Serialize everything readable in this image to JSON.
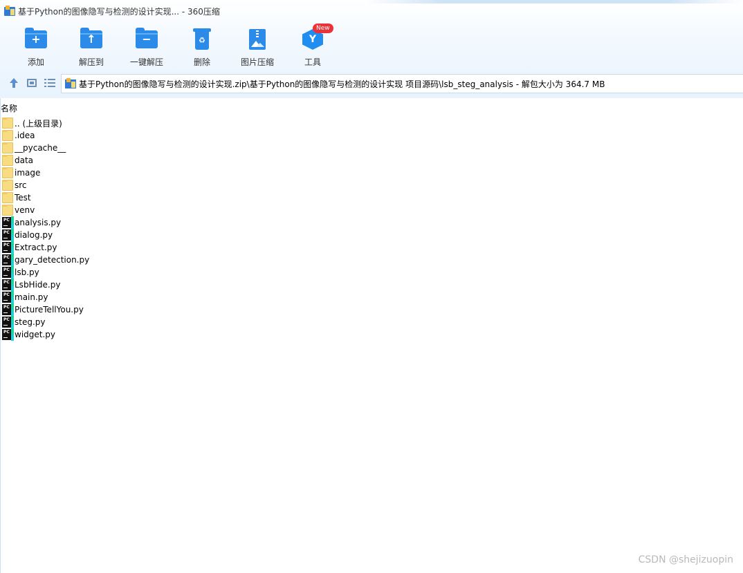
{
  "window": {
    "title": "基于Python的图像隐写与检测的设计实现... - 360压缩"
  },
  "toolbar": {
    "tools": [
      {
        "label": "添加",
        "icon": "add-folder-icon"
      },
      {
        "label": "解压到",
        "icon": "extract-to-icon"
      },
      {
        "label": "一键解压",
        "icon": "one-click-extract-icon"
      },
      {
        "label": "删除",
        "icon": "recycle-bin-icon"
      },
      {
        "label": "图片压缩",
        "icon": "image-compress-icon"
      },
      {
        "label": "工具",
        "icon": "tools-icon",
        "badge": "New"
      }
    ]
  },
  "address": {
    "path": "基于Python的图像隐写与检测的设计实现.zip\\基于Python的图像隐写与检测的设计实现 项目源码\\lsb_steg_analysis - 解包大小为 364.7 MB"
  },
  "list": {
    "column_name": "名称",
    "items": [
      {
        "name": ".. (上级目录)",
        "type": "folder"
      },
      {
        "name": ".idea",
        "type": "folder"
      },
      {
        "name": "__pycache__",
        "type": "folder"
      },
      {
        "name": "data",
        "type": "folder"
      },
      {
        "name": "image",
        "type": "folder"
      },
      {
        "name": "src",
        "type": "folder"
      },
      {
        "name": "Test",
        "type": "folder"
      },
      {
        "name": "venv",
        "type": "folder"
      },
      {
        "name": "analysis.py",
        "type": "py"
      },
      {
        "name": "dialog.py",
        "type": "py"
      },
      {
        "name": "Extract.py",
        "type": "py"
      },
      {
        "name": "gary_detection.py",
        "type": "py"
      },
      {
        "name": "lsb.py",
        "type": "py"
      },
      {
        "name": "LsbHide.py",
        "type": "py"
      },
      {
        "name": "main.py",
        "type": "py"
      },
      {
        "name": "PictureTellYou.py",
        "type": "py"
      },
      {
        "name": "steg.py",
        "type": "py"
      },
      {
        "name": "widget.py",
        "type": "py"
      }
    ]
  },
  "watermark": "CSDN @shejizuopin",
  "colors": {
    "accent": "#2c8be8",
    "badge": "#e8333a",
    "folder": "#f8dc82",
    "pycharm": "#111111"
  }
}
